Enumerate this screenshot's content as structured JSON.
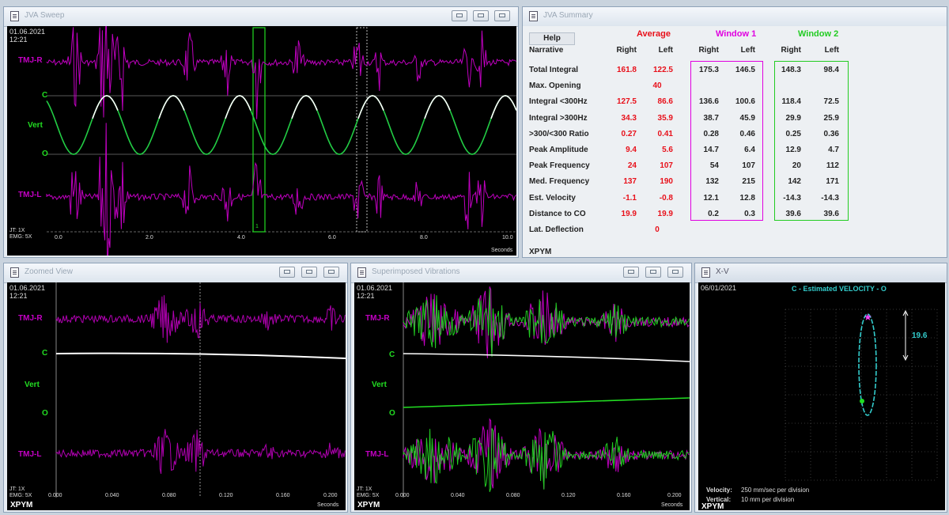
{
  "windows": {
    "sweep": {
      "title": "JVA Sweep"
    },
    "summary": {
      "title": "JVA Summary"
    },
    "zoomed": {
      "title": "Zoomed View"
    },
    "superimposed": {
      "title": "Superimposed Vibrations"
    },
    "xv": {
      "title": "X-V"
    }
  },
  "sweep": {
    "date": "01.06.2021",
    "time": "12:21",
    "tmj_r": "TMJ-R",
    "c": "C",
    "vert": "Vert",
    "o": "O",
    "tmj_l": "TMJ-L",
    "jt": "JT: 1X",
    "emg": "EMG: 5X",
    "x_ticks": [
      "0.0",
      "2.0",
      "4.0",
      "6.0",
      "8.0",
      "10.0"
    ],
    "window_labels": [
      "1",
      "2"
    ],
    "units": "Seconds"
  },
  "summary": {
    "help": "Help",
    "narrative": "Narrative",
    "groups": [
      "Average",
      "Window 1",
      "Window 2"
    ],
    "cols": [
      "Right",
      "Left",
      "Right",
      "Left",
      "Right",
      "Left"
    ],
    "rows": [
      {
        "name": "Total Integral",
        "v": [
          "161.8",
          "122.5",
          "175.3",
          "146.5",
          "148.3",
          "98.4"
        ]
      },
      {
        "name": "Max. Opening",
        "v": [
          "40",
          "",
          "",
          "",
          "",
          ""
        ]
      },
      {
        "name": "Integral <300Hz",
        "v": [
          "127.5",
          "86.6",
          "136.6",
          "100.6",
          "118.4",
          "72.5"
        ]
      },
      {
        "name": "Integral >300Hz",
        "v": [
          "34.3",
          "35.9",
          "38.7",
          "45.9",
          "29.9",
          "25.9"
        ]
      },
      {
        "name": ">300/<300 Ratio",
        "v": [
          "0.27",
          "0.41",
          "0.28",
          "0.46",
          "0.25",
          "0.36"
        ]
      },
      {
        "name": "Peak Amplitude",
        "v": [
          "9.4",
          "5.6",
          "14.7",
          "6.4",
          "12.9",
          "4.7"
        ]
      },
      {
        "name": "Peak Frequency",
        "v": [
          "24",
          "107",
          "54",
          "107",
          "20",
          "112"
        ]
      },
      {
        "name": "Med. Frequency",
        "v": [
          "137",
          "190",
          "132",
          "215",
          "142",
          "171"
        ]
      },
      {
        "name": "Est. Velocity",
        "v": [
          "-1.1",
          "-0.8",
          "12.1",
          "12.8",
          "-14.3",
          "-14.3"
        ]
      },
      {
        "name": "Distance to CO",
        "v": [
          "19.9",
          "19.9",
          "0.2",
          "0.3",
          "39.6",
          "39.6"
        ]
      },
      {
        "name": "Lat. Deflection",
        "v": [
          "0",
          "",
          "",
          "",
          "",
          ""
        ]
      }
    ],
    "footer": "XPYM",
    "colors": {
      "average": "#e8101a",
      "window1": "#e000e0",
      "window2": "#22cc22"
    }
  },
  "zoomed": {
    "date": "01.06.2021",
    "time": "12:21",
    "tmj_r": "TMJ-R",
    "c": "C",
    "vert": "Vert",
    "o": "O",
    "tmj_l": "TMJ-L",
    "jt": "JT: 1X",
    "emg": "EMG: 5X",
    "x_ticks": [
      "0.000",
      "0.040",
      "0.080",
      "0.120",
      "0.160",
      "0.200"
    ],
    "units": "Seconds",
    "footer": "XPYM"
  },
  "superimposed": {
    "date": "01.06.2021",
    "time": "12:21",
    "tmj_r": "TMJ-R",
    "c": "C",
    "vert": "Vert",
    "o": "O",
    "tmj_l": "TMJ-L",
    "jt": "JT: 1X",
    "emg": "EMG: 5X",
    "x_ticks": [
      "0.000",
      "0.040",
      "0.080",
      "0.120",
      "0.160",
      "0.200"
    ],
    "units": "Seconds",
    "footer": "XPYM"
  },
  "xv": {
    "date": "06/01/2021",
    "title": "C - Estimated VELOCITY - O",
    "value": "19.6",
    "velocity_label": "Velocity:",
    "velocity_text": "250 mm/sec per division",
    "vertical_label": "Vertical:",
    "vertical_text": "10 mm per division",
    "footer": "XPYM"
  }
}
